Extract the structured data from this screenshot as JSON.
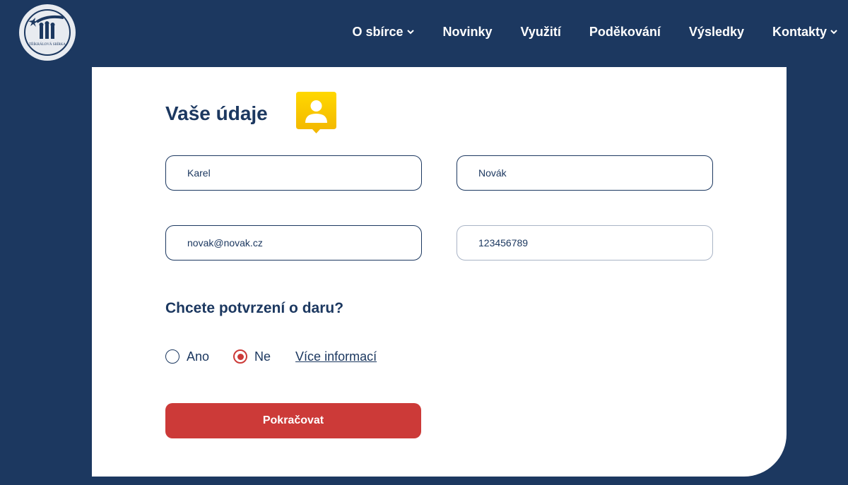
{
  "header": {
    "logo_text": "TŘÍKRÁLOVÁ SBÍRKA",
    "nav": [
      {
        "label": "O sbírce",
        "has_dropdown": true
      },
      {
        "label": "Novinky",
        "has_dropdown": false
      },
      {
        "label": "Využití",
        "has_dropdown": false
      },
      {
        "label": "Poděkování",
        "has_dropdown": false
      },
      {
        "label": "Výsledky",
        "has_dropdown": false
      },
      {
        "label": "Kontakty",
        "has_dropdown": true
      }
    ]
  },
  "form": {
    "title": "Vaše údaje",
    "title_icon": "user-icon",
    "first_name": "Karel",
    "last_name": "Novák",
    "email": "novak@novak.cz",
    "phone": "123456789",
    "question": "Chcete potvrzení o daru?",
    "options": [
      {
        "label": "Ano",
        "checked": false
      },
      {
        "label": "Ne",
        "checked": true
      }
    ],
    "info_link": "Více informací",
    "submit_label": "Pokračovat"
  },
  "colors": {
    "background": "#1c3860",
    "accent": "#cc3a38",
    "badge": "#f5c800",
    "card": "#ffffff"
  }
}
